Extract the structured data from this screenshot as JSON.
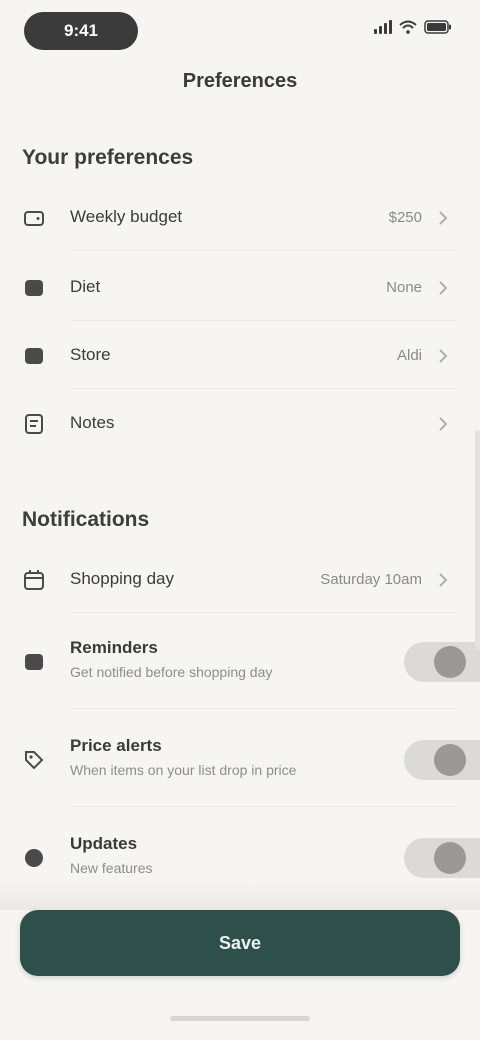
{
  "status_bar": {
    "time": "9:41"
  },
  "header": {
    "title": "Preferences"
  },
  "sections": {
    "preferences": {
      "heading": "Your preferences",
      "items": [
        {
          "label": "Weekly budget",
          "value": "$250",
          "icon": "wallet-icon"
        },
        {
          "label": "Diet",
          "value": "None",
          "icon": "leaf-icon"
        },
        {
          "label": "Store",
          "value": "Aldi",
          "icon": "store-icon"
        },
        {
          "label": "Notes",
          "value": "",
          "icon": "note-icon"
        }
      ]
    },
    "notifications": {
      "heading": "Notifications",
      "reminder": {
        "label": "Shopping day",
        "value": "Saturday 10am",
        "icon": "calendar-icon"
      },
      "toggles": [
        {
          "label": "Reminders",
          "subtitle": "Get notified before shopping day",
          "icon": "bell-icon",
          "on": false
        },
        {
          "label": "Price alerts",
          "subtitle": "When items on your list drop in price",
          "icon": "tag-icon",
          "on": false
        },
        {
          "label": "Updates",
          "subtitle": "New features",
          "icon": "sparkle-icon",
          "on": false
        }
      ]
    }
  },
  "footer": {
    "save_label": "Save"
  },
  "colors": {
    "accent": "#2f4f4b",
    "background": "#f7f5f2"
  }
}
